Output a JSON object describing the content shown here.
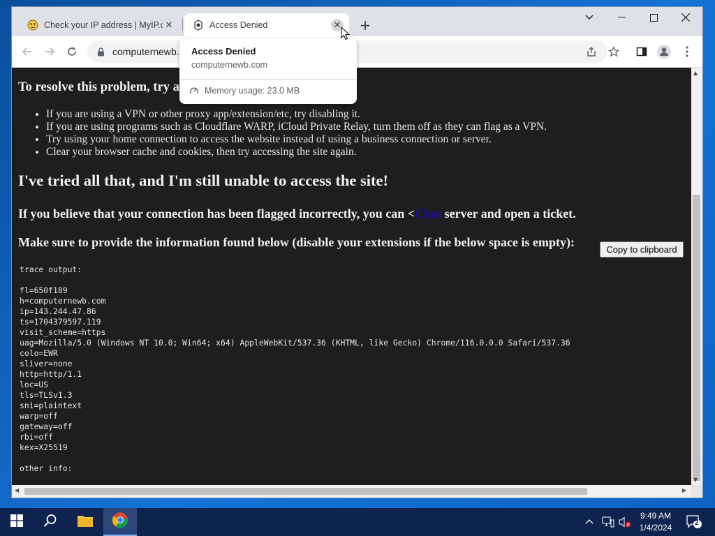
{
  "browser": {
    "tabs": [
      {
        "title": "Check your IP address | MyIP.com",
        "active": false,
        "favicon": "myip-icon"
      },
      {
        "title": "Access Denied",
        "active": true,
        "favicon": "site-icon"
      }
    ],
    "url": "computernewb.com"
  },
  "hovercard": {
    "title": "Access Denied",
    "domain": "computernewb.com",
    "memory": "Memory usage: 23.0 MB"
  },
  "page": {
    "heading": "To resolve this problem, try a",
    "bullets": [
      "If you are using a VPN or other proxy app/extension/etc, try disabling it.",
      "If you are using programs such as Cloudflare WARP, iCloud Private Relay, turn them off as they can flag as a VPN.",
      "Try using your home connection to access the website instead of using a business connection or server.",
      "Clear your browser cache and cookies, then try accessing the site again."
    ],
    "h2": "I've tried all that, and I'm still unable to access the site!",
    "p1_before": "If you believe that your connection has been flagged incorrectly, you can <",
    "p1_link": "Chat",
    "p1_after": " server and open a ticket.",
    "p2": "Make sure to provide the information found below (disable your extensions if the below space is empty):",
    "copy_button": "Copy to clipboard",
    "trace": "trace output:\n\nfl=650f189\nh=computernewb.com\nip=143.244.47.86\nts=1704379597.119\nvisit_scheme=https\nuag=Mozilla/5.0 (Windows NT 10.0; Win64; x64) AppleWebKit/537.36 (KHTML, like Gecko) Chrome/116.0.0.0 Safari/537.36\ncolo=EWR\nsliver=none\nhttp=http/1.1\nloc=US\ntls=TLSv1.3\nsni=plaintext\nwarp=off\ngateway=off\nrbi=off\nkex=X25519\n\nother info:"
  },
  "taskbar": {
    "time": "9:49 AM",
    "date": "1/4/2024",
    "notifications": "2"
  },
  "colors": {
    "page_bg": "#1e1e1e",
    "taskbar_bg": "#0f2350",
    "link": "#1a0dab"
  }
}
